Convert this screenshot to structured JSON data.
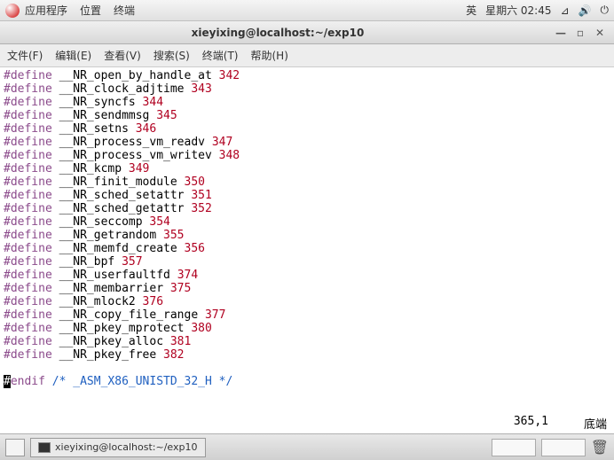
{
  "top_panel": {
    "apps": "应用程序",
    "places": "位置",
    "terminal": "终端",
    "ime": "英",
    "date": "星期六 02:45"
  },
  "window": {
    "title": "xieyixing@localhost:~/exp10"
  },
  "menubar": {
    "file": "文件(F)",
    "edit": "编辑(E)",
    "view": "查看(V)",
    "search": "搜索(S)",
    "terminal": "终端(T)",
    "help": "帮助(H)"
  },
  "code_lines": [
    {
      "kw": "#define",
      "name": "__NR_open_by_handle_at",
      "num": "342"
    },
    {
      "kw": "#define",
      "name": "__NR_clock_adjtime",
      "num": "343"
    },
    {
      "kw": "#define",
      "name": "__NR_syncfs",
      "num": "344"
    },
    {
      "kw": "#define",
      "name": "__NR_sendmmsg",
      "num": "345"
    },
    {
      "kw": "#define",
      "name": "__NR_setns",
      "num": "346"
    },
    {
      "kw": "#define",
      "name": "__NR_process_vm_readv",
      "num": "347"
    },
    {
      "kw": "#define",
      "name": "__NR_process_vm_writev",
      "num": "348"
    },
    {
      "kw": "#define",
      "name": "__NR_kcmp",
      "num": "349"
    },
    {
      "kw": "#define",
      "name": "__NR_finit_module",
      "num": "350"
    },
    {
      "kw": "#define",
      "name": "__NR_sched_setattr",
      "num": "351"
    },
    {
      "kw": "#define",
      "name": "__NR_sched_getattr",
      "num": "352"
    },
    {
      "kw": "#define",
      "name": "__NR_seccomp",
      "num": "354"
    },
    {
      "kw": "#define",
      "name": "__NR_getrandom",
      "num": "355"
    },
    {
      "kw": "#define",
      "name": "__NR_memfd_create",
      "num": "356"
    },
    {
      "kw": "#define",
      "name": "__NR_bpf",
      "num": "357"
    },
    {
      "kw": "#define",
      "name": "__NR_userfaultfd",
      "num": "374"
    },
    {
      "kw": "#define",
      "name": "__NR_membarrier",
      "num": "375"
    },
    {
      "kw": "#define",
      "name": "__NR_mlock2",
      "num": "376"
    },
    {
      "kw": "#define",
      "name": "__NR_copy_file_range",
      "num": "377"
    },
    {
      "kw": "#define",
      "name": "__NR_pkey_mprotect",
      "num": "380"
    },
    {
      "kw": "#define",
      "name": "__NR_pkey_alloc",
      "num": "381"
    },
    {
      "kw": "#define",
      "name": "__NR_pkey_free",
      "num": "382"
    }
  ],
  "endif_cursor": "#",
  "endif_rest": "endif",
  "endif_comment": "/* _ASM_X86_UNISTD_32_H */",
  "status": {
    "pos": "365,1",
    "mode": "底端"
  },
  "taskbar": {
    "task_title": "xieyixing@localhost:~/exp10"
  }
}
